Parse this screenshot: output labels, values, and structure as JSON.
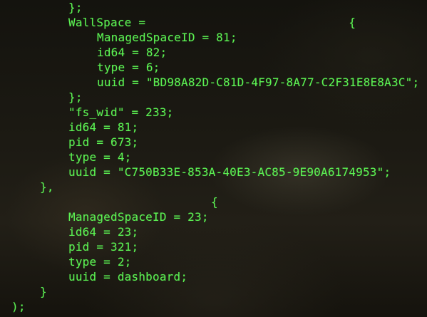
{
  "theme": {
    "text_color": "#5cf253",
    "background_color": "#1a1812"
  },
  "terminal": {
    "lines": [
      "};",
      "WallSpace =                             {",
      "ManagedSpaceID = 81;",
      "id64 = 82;",
      "type = 6;",
      "uuid = \"BD98A82D-C81D-4F97-8A77-C2F31E8E8A3C\";",
      "};",
      "\"fs_wid\" = 233;",
      "id64 = 81;",
      "pid = 673;",
      "type = 4;",
      "uuid = \"C750B33E-853A-40E3-AC85-9E90A6174953\";",
      "},",
      "{",
      "ManagedSpaceID = 23;",
      "id64 = 23;",
      "pid = 321;",
      "type = 2;",
      "uuid = dashboard;",
      "}",
      ");"
    ]
  }
}
